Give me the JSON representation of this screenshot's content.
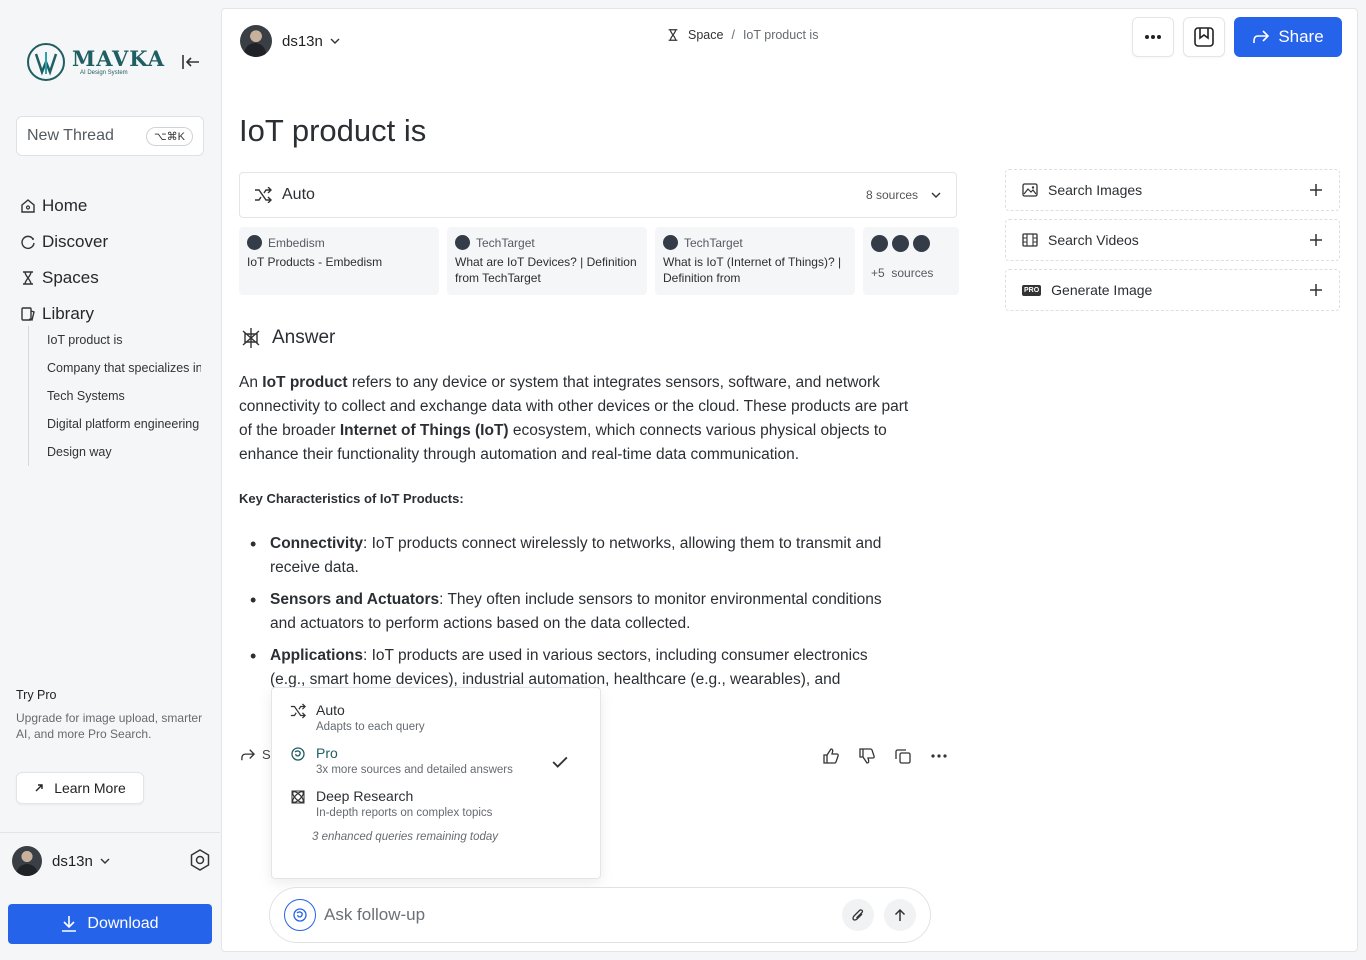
{
  "sidebar": {
    "logo_word": "MAVKA",
    "logo_sub": "AI Design System",
    "new_thread_label": "New Thread",
    "new_thread_shortcut": "⌥⌘K",
    "nav": [
      {
        "label": "Home",
        "icon": "home-icon"
      },
      {
        "label": "Discover",
        "icon": "discover-icon"
      },
      {
        "label": "Spaces",
        "icon": "spaces-icon"
      },
      {
        "label": "Library",
        "icon": "library-icon"
      }
    ],
    "library_items": [
      "IoT product is",
      "Company that specializes in",
      "Tech Systems",
      "Digital platform engineering",
      "Design way"
    ],
    "try_pro_title": "Try Pro",
    "try_pro_desc": "Upgrade for image upload, smarter AI, and more Pro Search.",
    "learn_more_label": "Learn More",
    "user_name": "ds13n",
    "download_label": "Download"
  },
  "header": {
    "user_name": "ds13n",
    "breadcrumb_space": "Space",
    "breadcrumb_sep": "/",
    "breadcrumb_current": "IoT product is",
    "share_label": "Share"
  },
  "thread": {
    "title": "IoT product is",
    "mode_label": "Auto",
    "sources_count": "8 sources",
    "sources": [
      {
        "site": "Embedism",
        "title": "IoT Products - Embedism"
      },
      {
        "site": "TechTarget",
        "title": "What are IoT Devices? | Definition from TechTarget"
      },
      {
        "site": "TechTarget",
        "title": "What is IoT (Internet of Things)? | Definition from"
      }
    ],
    "more_sources_count": "+5",
    "more_sources_label": "sources",
    "answer_heading": "Answer",
    "answer": {
      "p1_a": "An ",
      "p1_b": "IoT product",
      "p1_c": " refers to any device or system that integrates sensors, software, and network connectivity to collect and exchange data with other devices or the cloud. These products are part of the broader ",
      "p1_d": "Internet of Things (IoT)",
      "p1_e": " ecosystem, which connects various physical objects to enhance their functionality through automation and real-time data communication."
    },
    "key_heading": "Key Characteristics of IoT Products:",
    "bullets": [
      {
        "term": "Connectivity",
        "text": ": IoT products connect wirelessly to networks, allowing them to transmit and receive data."
      },
      {
        "term": "Sensors and Actuators",
        "text": ": They often include sensors to monitor environmental conditions and actuators to perform actions based on the data collected."
      },
      {
        "term": "Applications",
        "text": ": IoT products are used in various sectors, including consumer electronics (e.g., smart home devices), industrial automation, healthcare (e.g., wearables), and"
      }
    ],
    "share_action_label": "S"
  },
  "mode_menu": {
    "items": [
      {
        "title": "Auto",
        "desc": "Adapts to each query"
      },
      {
        "title": "Pro",
        "desc": "3x more sources and detailed answers"
      },
      {
        "title": "Deep Research",
        "desc": "In-depth reports on complex topics"
      }
    ],
    "footer": "3 enhanced queries remaining today"
  },
  "ask": {
    "placeholder": "Ask follow-up"
  },
  "tools": [
    {
      "label": "Search Images"
    },
    {
      "label": "Search Videos"
    },
    {
      "label": "Generate Image",
      "tag": "PRO"
    }
  ],
  "colors": {
    "accent": "#2563eb",
    "brand": "#1f5e62"
  }
}
